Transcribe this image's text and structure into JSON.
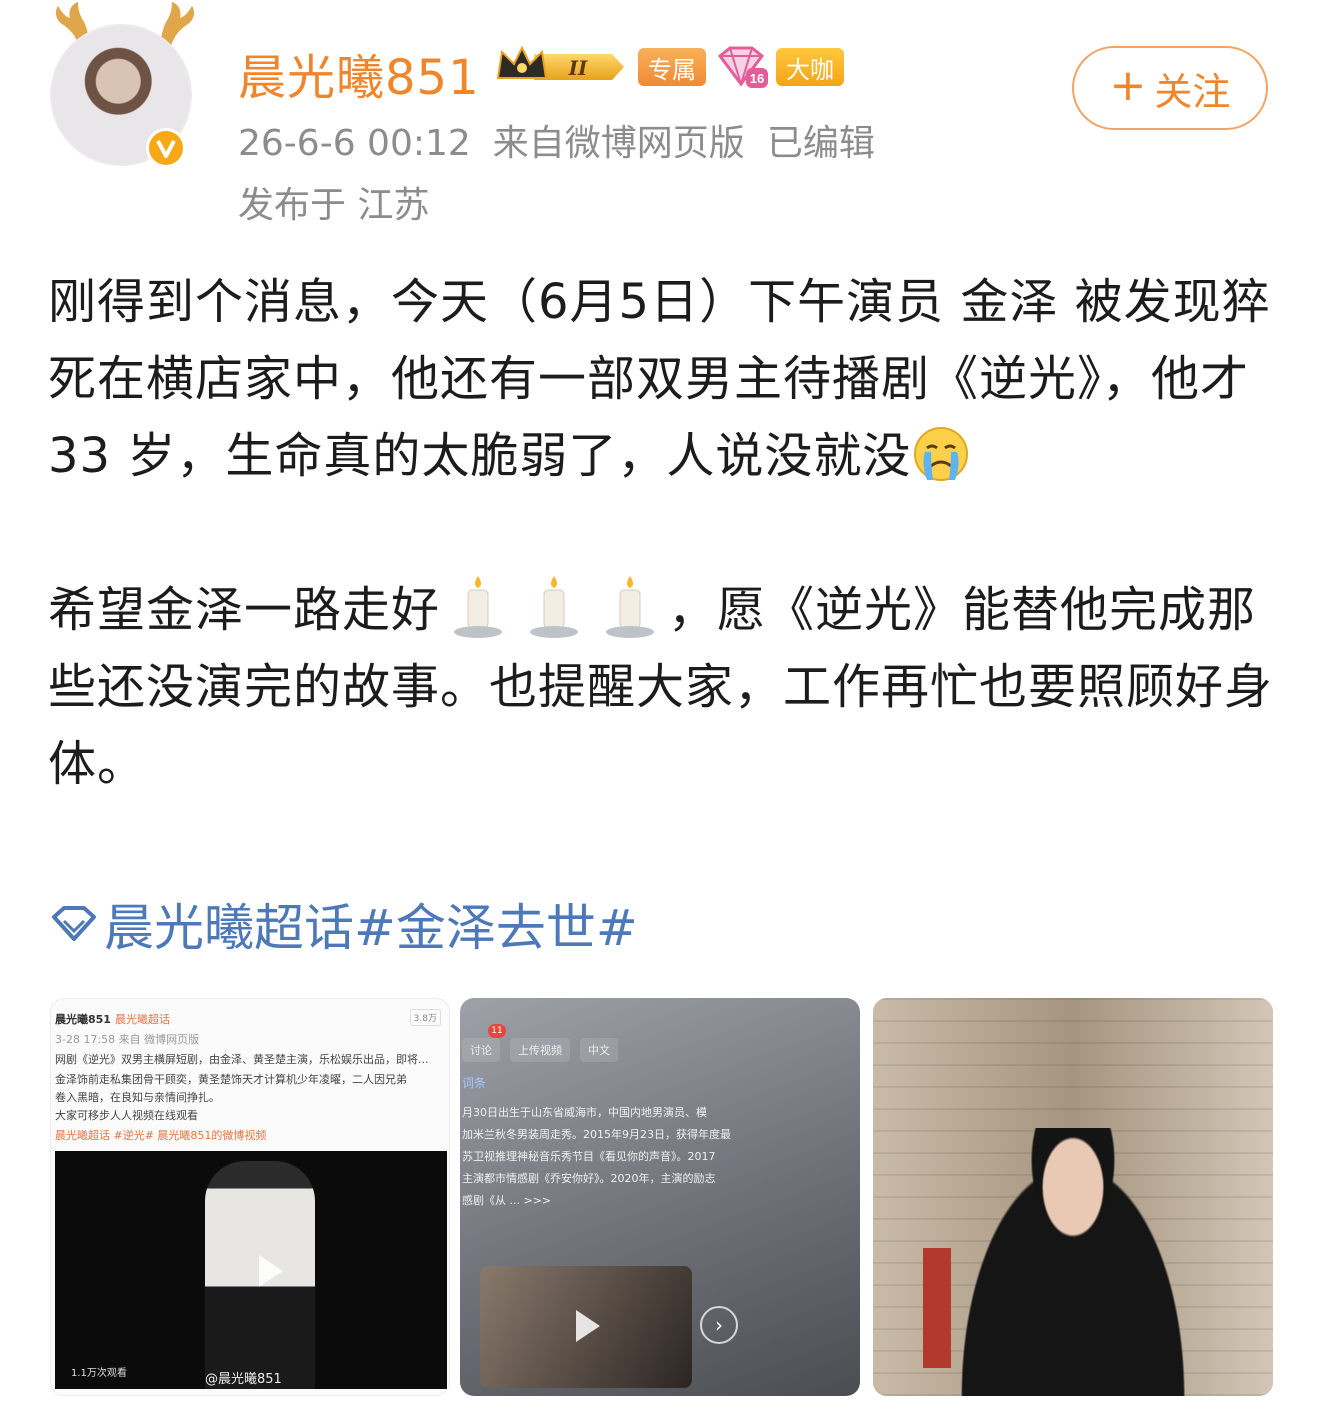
{
  "header": {
    "username": "晨光曦851",
    "level_badge": "II",
    "tags": [
      "专属",
      "大咖"
    ],
    "diamond_level": "16",
    "timestamp": "26-6-6 00:12",
    "source": "来自微博网页版",
    "edited": "已编辑",
    "location": "发布于 江苏",
    "follow_label": "关注",
    "follow_plus": "+"
  },
  "post": {
    "paragraph1": "刚得到个消息，今天（6月5日）下午演员 金泽 被发现猝死在横店家中，他还有一部双男主待播剧《逆光》，他才 33 岁，生命真的太脆弱了，人说没就没",
    "paragraph2_before": "希望金泽一路走好",
    "paragraph2_after": "，愿《逆光》能替他完成那些还没演完的故事。也提醒大家，工作再忙也要照顾好身体。",
    "topic_super": "晨光曦超话",
    "topic_hashtag": "#金泽去世#"
  },
  "images": {
    "img1": {
      "user": "晨光曦851",
      "supertopic": "晨光曦超话",
      "time": "3-28 17:58 来自 微博网页版",
      "views_badge": "3.8万",
      "line1": "网剧《逆光》双男主横屏短剧，由金泽、黄圣楚主演，乐松娱乐出品，即将...",
      "line2": "金泽饰前走私集团骨干顾奕，黄圣楚饰天才计算机少年凌曜，二人因兄弟",
      "line3": "卷入黑暗，在良知与亲情间挣扎。",
      "line4": "大家可移步人人视频在线观看",
      "tags": "晨光曦超话 #逆光# 晨光曦851的微博视频",
      "play_count": "1.1万次观看",
      "watermark": "@晨光曦851"
    },
    "img2": {
      "badge": "11",
      "tabs": [
        "讨论",
        "上传视频",
        "中文"
      ],
      "section": "词条",
      "line1": "月30日出生于山东省威海市，中国内地男演员、模",
      "line2": "加米兰秋冬男装周走秀。2015年9月23日，获得年度最",
      "line3": "苏卫视推理神秘音乐秀节目《看见你的声音》。2017",
      "line4": "主演都市情感剧《乔安你好》。2020年，主演的励志",
      "line5": "感剧《从 ... >>>",
      "next": "›"
    }
  },
  "colors": {
    "username": "#f0862c",
    "link": "#4e79b8",
    "meta": "#8c8c8c"
  }
}
